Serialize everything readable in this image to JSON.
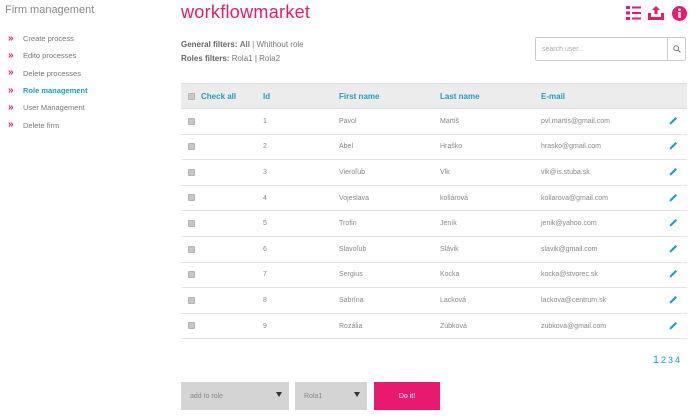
{
  "sidebar": {
    "title": "Firm management",
    "items": [
      {
        "label": "Create process",
        "active": false
      },
      {
        "label": "Edito processes",
        "active": false
      },
      {
        "label": "Delete processes",
        "active": false
      },
      {
        "label": "Role management",
        "active": true
      },
      {
        "label": "User Management",
        "active": false
      },
      {
        "label": "Delete firm",
        "active": false
      }
    ]
  },
  "header": {
    "brand": "workflowmarket",
    "icons": [
      "list-icon",
      "upload-box-icon",
      "info-icon"
    ],
    "accent_color": "#e8196f",
    "link_color": "#1a9fc4"
  },
  "filters": {
    "general_label": "General filters:",
    "general_options": [
      "All",
      "Whithout role"
    ],
    "roles_label": "Roles filters:",
    "roles_options": [
      "Rola1",
      "Rola2"
    ]
  },
  "search": {
    "placeholder": "search user..."
  },
  "table": {
    "headers": {
      "check": "Check all",
      "id": "Id",
      "first": "First name",
      "last": "Last name",
      "email": "E-mail"
    },
    "rows": [
      {
        "id": "1",
        "first": "Pavol",
        "last": "Martiš",
        "email": "pvl.martis@gmail.com"
      },
      {
        "id": "2",
        "first": "Abel",
        "last": "Hraško",
        "email": "hrasko@gmail.com"
      },
      {
        "id": "3",
        "first": "Vieroľub",
        "last": "Vlk",
        "email": "vlk@is.stuba.sk"
      },
      {
        "id": "4",
        "first": "Vojeslava",
        "last": "kollárová",
        "email": "kollarova@gmail.com"
      },
      {
        "id": "5",
        "first": "Trofin",
        "last": "Jeník",
        "email": "jenik@yahoo.com"
      },
      {
        "id": "6",
        "first": "Slavoľub",
        "last": "Slávik",
        "email": "slavik@gmail.com"
      },
      {
        "id": "7",
        "first": "Sergius",
        "last": "Kocka",
        "email": "kocka@stvorec.sk"
      },
      {
        "id": "8",
        "first": "Sabrína",
        "last": "Lacková",
        "email": "lackova@centrum.sk"
      },
      {
        "id": "9",
        "first": "Rozália",
        "last": "Zúbková",
        "email": "zubkova@gmail.com"
      }
    ]
  },
  "pagination": {
    "pages": [
      "1",
      "2",
      "3",
      "4"
    ],
    "current": "1"
  },
  "actions": {
    "add_to_role": "add to role",
    "role_value": "Rola1",
    "submit": "Do it!"
  }
}
